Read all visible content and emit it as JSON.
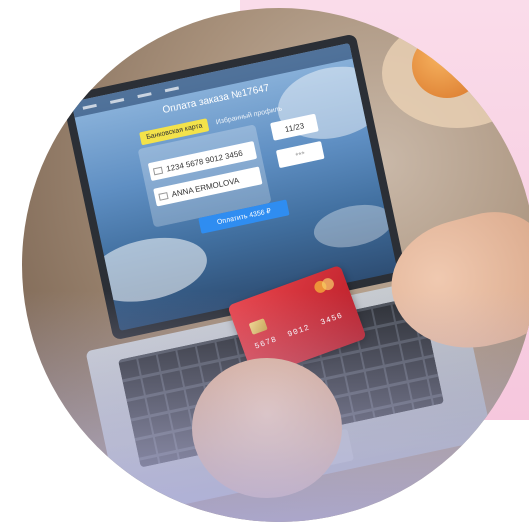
{
  "screen": {
    "order_title": "Оплата заказа №17647",
    "tabs": {
      "active": "Банковская карта",
      "inactive": "Избранный профиль"
    },
    "fields": {
      "card_number": "1234 5678 9012 3456",
      "card_holder": "ANNA ERMOLOVA",
      "expiry": "11/23",
      "cvv": "***"
    },
    "pay_button": "Оплатить 4356 ₽"
  },
  "credit_card": {
    "number_groups": [
      "5678",
      "9012",
      "3456"
    ]
  },
  "colors": {
    "pink_background": "#f8d3e4",
    "pay_button": "#2f8df1",
    "active_tab": "#f3e24a",
    "credit_card": "#d7323b"
  }
}
